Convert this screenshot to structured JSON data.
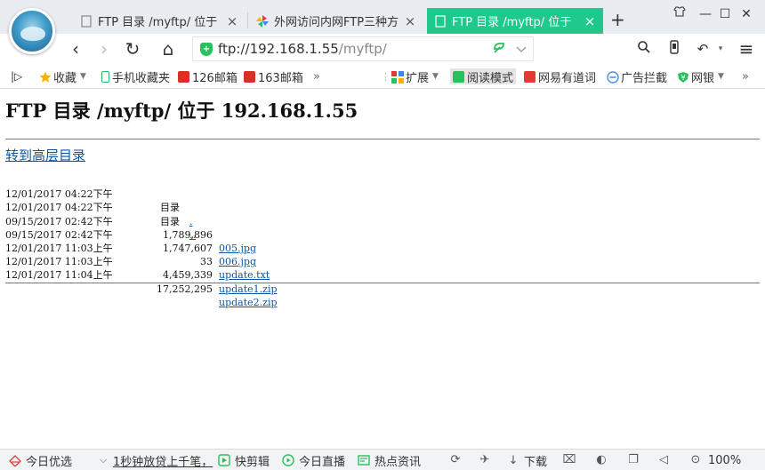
{
  "tabs": [
    {
      "label": "FTP 目录 /myftp/ 位于",
      "close": "×"
    },
    {
      "label": "外网访问内网FTP三种方",
      "close": "×"
    },
    {
      "label": "FTP 目录 /myftp/ 位于",
      "close": "×",
      "active": true
    }
  ],
  "tabbar": {
    "new_tab": "+",
    "skin": "♡",
    "minimize": "—",
    "maximize": "☐",
    "close": "✕"
  },
  "nav": {
    "back": "‹",
    "forward": "›",
    "reload": "↻",
    "home": "⌂",
    "url_host": "ftp://192.168.1.55",
    "url_path": "/myftp/",
    "search_icon": "search-icon",
    "reader_icon": "phone-icon",
    "undo": "↶",
    "menu": "≡"
  },
  "bookmarks": {
    "toggle": "|▷",
    "items": [
      {
        "label": "收藏",
        "icon_color": "#f4b400"
      },
      {
        "label": "手机收藏夹",
        "icon_color": "#2cbf60"
      },
      {
        "label": "126邮箱",
        "icon_color": "#d93025"
      },
      {
        "label": "163邮箱",
        "icon_color": "#d93025"
      }
    ],
    "more": "»",
    "right_items": [
      {
        "label": "扩展",
        "icon_color": "#4285f4"
      },
      {
        "label": "阅读模式",
        "icon_color": "#2cbf60"
      },
      {
        "label": "网易有道词",
        "icon_color": "#e53935"
      },
      {
        "label": "广告拦截",
        "icon_color": "#4a90e2"
      },
      {
        "label": "网银",
        "icon_color": "#2cbf60"
      }
    ],
    "more_right": "»"
  },
  "page": {
    "title": "FTP 目录 /myftp/ 位于 192.168.1.55",
    "up_link": "转到高层目录",
    "entries": [
      {
        "date": "12/01/2017 04:22下午",
        "size": "",
        "kind": "目录",
        "name": "."
      },
      {
        "date": "12/01/2017 04:22下午",
        "size": "",
        "kind": "目录",
        "name": ".."
      },
      {
        "date": "09/15/2017 02:42下午",
        "size": "1,789,896",
        "kind": "",
        "name": "005.jpg"
      },
      {
        "date": "09/15/2017 02:42下午",
        "size": "1,747,607",
        "kind": "",
        "name": "006.jpg"
      },
      {
        "date": "12/01/2017 11:03上午",
        "size": "33",
        "kind": "",
        "name": "update.txt"
      },
      {
        "date": "12/01/2017 11:03上午",
        "size": "4,459,339",
        "kind": "",
        "name": "update1.zip"
      },
      {
        "date": "12/01/2017 11:04上午",
        "size": "17,252,295",
        "kind": "",
        "name": "update2.zip"
      }
    ]
  },
  "statusbar": {
    "today_pick": "今日优选",
    "news": "1秒钟放贷上千笔，",
    "clip": "快剪辑",
    "live": "今日直播",
    "hot": "热点资讯",
    "download": "下载",
    "zoom": "100%"
  },
  "colors": {
    "active_tab": "#1fc98c",
    "link": "#0b57a7",
    "accent_green": "#2cbf60"
  }
}
